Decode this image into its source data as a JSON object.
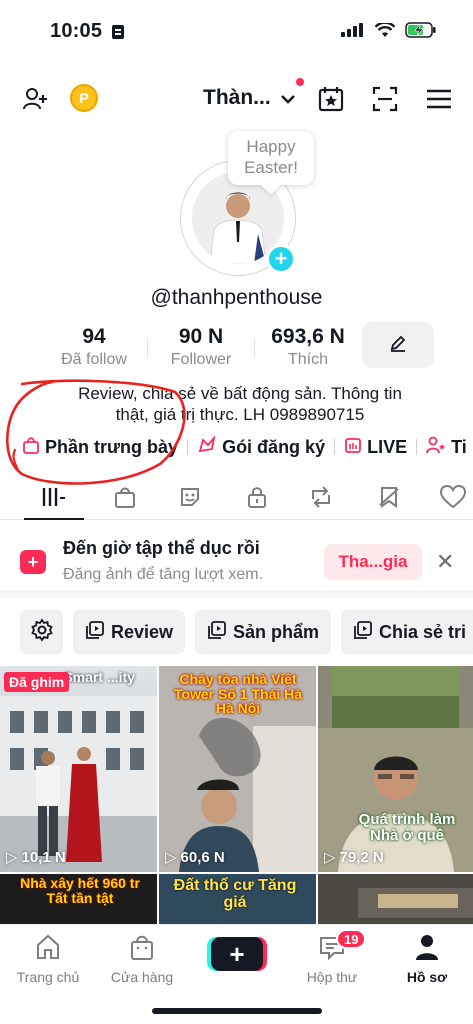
{
  "status_bar": {
    "time": "10:05"
  },
  "header": {
    "account_name": "Thàn...",
    "points_label": "P"
  },
  "profile": {
    "avatar_bubble": "Happy Easter!",
    "username": "@thanhpenthouse",
    "stats": [
      {
        "value": "94",
        "label": "Đã follow"
      },
      {
        "value": "90 N",
        "label": "Follower"
      },
      {
        "value": "693,6 N",
        "label": "Thích"
      }
    ],
    "bio_line1": "Review, chia sẻ về bất động sản. Thông tin",
    "bio_line2": "thật, giá trị thực. LH  0989890715",
    "links": [
      "Phần trưng bày",
      "Gói đăng ký",
      "LIVE",
      "Ti"
    ]
  },
  "promo": {
    "title": "Đến giờ tập thể dục rồi",
    "subtitle": "Đăng ảnh để tăng lượt xem.",
    "button": "Tha...gia"
  },
  "playlists": [
    "Review",
    "Sản phẩm",
    "Chia sẻ tri"
  ],
  "videos": [
    {
      "views": "10,1 N",
      "badge": "Đã ghim",
      "caption": "...s Smart ...ity"
    },
    {
      "views": "60,6 N",
      "caption": "Cháy tòa nhà Việt Tower Số 1 Thái Hà Hà Nội"
    },
    {
      "views": "79,2 N",
      "caption": "Quá trình làm Nhà ở quê"
    },
    {
      "caption": "Nhà xây hết 960 tr Tất tần tật"
    },
    {
      "caption": "Đất thổ cư Tăng giá"
    },
    {
      "caption": ""
    }
  ],
  "bottom_nav": {
    "home": "Trang chủ",
    "shop": "Cửa hàng",
    "create": "+",
    "inbox": "Hộp thư",
    "inbox_badge": "19",
    "profile": "Hồ sơ"
  },
  "colors": {
    "accent": "#fe2c55",
    "cyan": "#25f4ee",
    "text": "#161823",
    "muted": "#8a8b91"
  }
}
